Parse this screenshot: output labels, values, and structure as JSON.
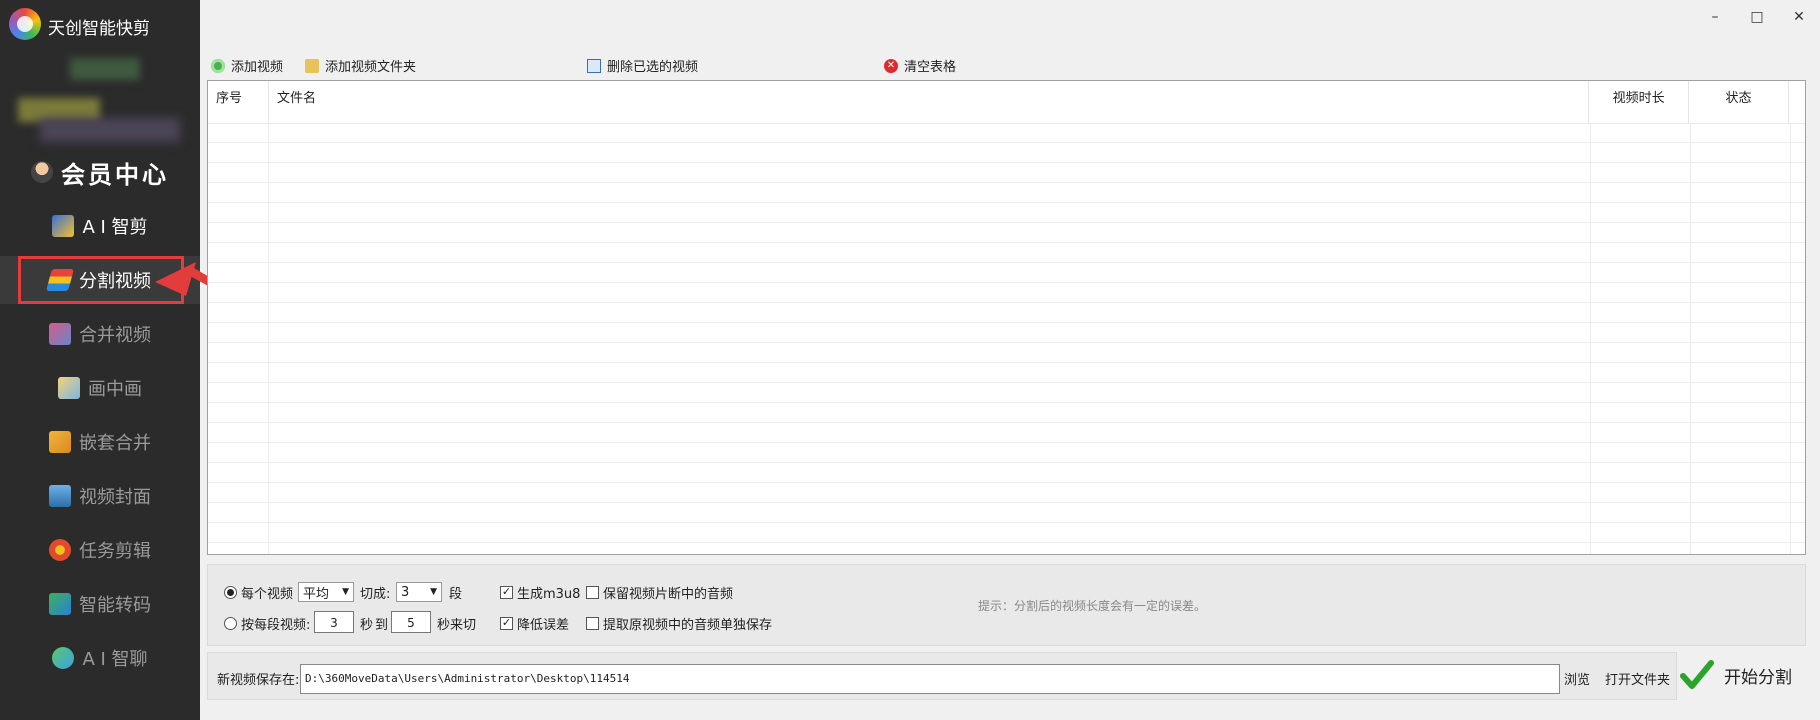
{
  "app": {
    "title": "天创智能快剪"
  },
  "window": {
    "minimize": "–",
    "maximize": "□",
    "close": "✕"
  },
  "sidebar": {
    "member": "会员中心",
    "items": [
      {
        "label": "A I 智剪"
      },
      {
        "label": "分割视频"
      },
      {
        "label": "合并视频"
      },
      {
        "label": "画中画"
      },
      {
        "label": "嵌套合并"
      },
      {
        "label": "视频封面"
      },
      {
        "label": "任务剪辑"
      },
      {
        "label": "智能转码"
      },
      {
        "label": "A I 智聊"
      }
    ]
  },
  "toolbar": {
    "add_video": "添加视频",
    "add_folder": "添加视频文件夹",
    "delete_selected": "删除已选的视频",
    "clear_table": "清空表格"
  },
  "table": {
    "columns": [
      "序号",
      "文件名",
      "视频时长",
      "状态"
    ]
  },
  "options": {
    "per_video_label": "每个视频",
    "mode_value": "平均",
    "cut_label": "切成:",
    "cut_value": "3",
    "segments_label": "段",
    "by_segment_label": "按每段视频:",
    "from_value": "3",
    "sec_label": "秒",
    "to_label": "到",
    "to_value": "5",
    "sec_cut_label": "秒来切",
    "m3u8_label": "生成m3u8",
    "reduce_error_label": "降低误差",
    "keep_audio_label": "保留视频片断中的音频",
    "extract_audio_label": "提取原视频中的音频单独保存",
    "hint": "提示：分割后的视频长度会有一定的误差。"
  },
  "save": {
    "label": "新视频保存在:",
    "path": "D:\\360MoveData\\Users\\Administrator\\Desktop\\114514",
    "browse": "浏览",
    "open_folder": "打开文件夹",
    "start": "开始分割"
  },
  "colors": {
    "sidebar_bg": "#2b2b2b",
    "highlight": "#e23c3c",
    "start_check": "#2aa52a"
  }
}
